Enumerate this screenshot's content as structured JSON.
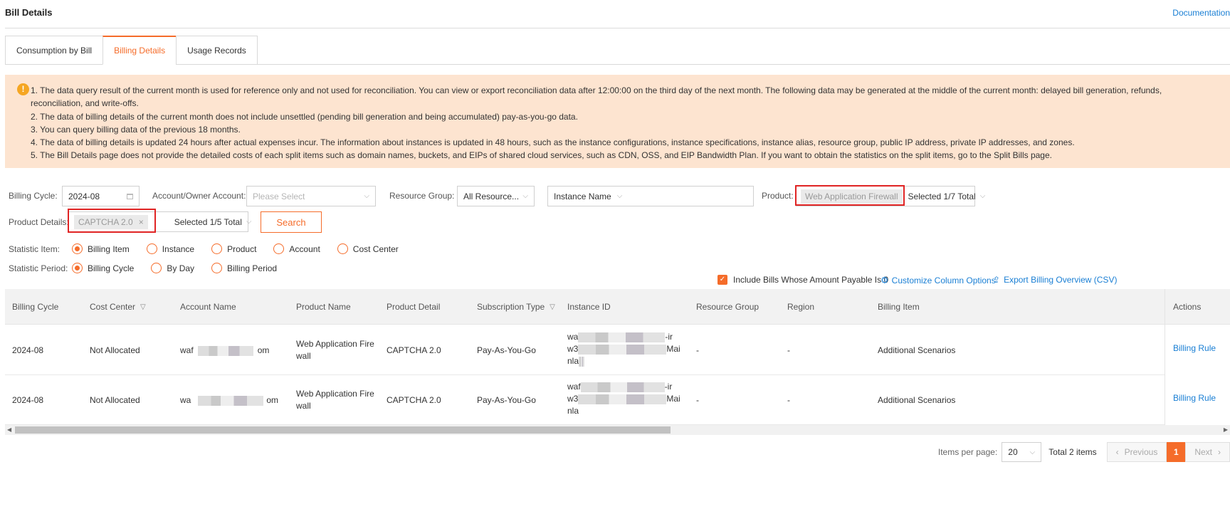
{
  "page": {
    "title": "Bill Details",
    "doc_link": "Documentation"
  },
  "tabs": [
    {
      "label": "Consumption by Bill",
      "active": false
    },
    {
      "label": "Billing Details",
      "active": true
    },
    {
      "label": "Usage Records",
      "active": false
    }
  ],
  "notice": {
    "icon": "info-icon",
    "lines": [
      "1. The data query result of the current month is used for reference only and not used for reconciliation. You can view or export reconciliation data after 12:00:00 on the third day of the next month. The following data may be generated at the middle of the current month: delayed bill generation, refunds,",
      "reconciliation, and write-offs.",
      "2. The data of billing details of the current month does not include unsettled (pending bill generation and being accumulated) pay-as-you-go data.",
      "3. You can query billing data of the previous 18 months.",
      "4. The data of billing details is updated 24 hours after actual expenses incur. The information about instances is updated in 48 hours, such as the instance configurations, instance specifications, instance alias, resource group, public IP address, private IP addresses, and zones.",
      "5. The Bill Details page does not provide the detailed costs of each split items such as domain names, buckets, and EIPs of shared cloud services, such as CDN, OSS, and EIP Bandwidth Plan. If you want to obtain the statistics on the split items, go to the Split Bills page."
    ]
  },
  "filters": {
    "billing_cycle_label": "Billing Cycle:",
    "billing_cycle_value": "2024-08",
    "account_label": "Account/Owner Account:",
    "account_placeholder": "Please Select",
    "resource_group_label": "Resource Group:",
    "resource_group_value": "All Resource...",
    "instance_name_value": "Instance Name",
    "product_label": "Product:",
    "product_tag": "Web Application Firewall",
    "product_selected": "Selected 1/7 Total",
    "product_details_label": "Product Details:",
    "product_details_tag": "CAPTCHA 2.0",
    "product_details_tag_close": "×",
    "product_details_selected": "Selected 1/5 Total",
    "search_label": "Search"
  },
  "statistic_item": {
    "label": "Statistic Item:",
    "options": [
      {
        "label": "Billing Item",
        "checked": true
      },
      {
        "label": "Instance",
        "checked": false
      },
      {
        "label": "Product",
        "checked": false
      },
      {
        "label": "Account",
        "checked": false
      },
      {
        "label": "Cost Center",
        "checked": false
      }
    ]
  },
  "statistic_period": {
    "label": "Statistic Period:",
    "options": [
      {
        "label": "Billing Cycle",
        "checked": true
      },
      {
        "label": "By Day",
        "checked": false
      },
      {
        "label": "Billing Period",
        "checked": false
      }
    ]
  },
  "toolbar": {
    "include_zero_label": "Include Bills Whose Amount Payable Is 0",
    "include_zero_checked": true,
    "customize_label": "Customize Column Options",
    "export_label": "Export Billing Overview (CSV)"
  },
  "table": {
    "columns": [
      "Billing Cycle",
      "Cost Center",
      "Account Name",
      "Product Name",
      "Product Detail",
      "Subscription Type",
      "Instance ID",
      "Resource Group",
      "Region",
      "Billing Item",
      "Actions"
    ],
    "rows": [
      {
        "billing_cycle": "2024-08",
        "cost_center": "Not Allocated",
        "account_prefix": "waf",
        "account_suffix": "om",
        "product_name_1": "Web Application Fire",
        "product_name_2": "wall",
        "product_detail": "CAPTCHA 2.0",
        "subscription_type": "Pay-As-You-Go",
        "instance_1a": "wa",
        "instance_1b": "-ir",
        "instance_2a": "w3",
        "instance_2b": "Mai",
        "instance_3a": "nla",
        "resource_group": "-",
        "region": "-",
        "billing_item": "Additional Scenarios",
        "action": "Billing Rule"
      },
      {
        "billing_cycle": "2024-08",
        "cost_center": "Not Allocated",
        "account_prefix": "wa",
        "account_suffix": "om",
        "product_name_1": "Web Application Fire",
        "product_name_2": "wall",
        "product_detail": "CAPTCHA 2.0",
        "subscription_type": "Pay-As-You-Go",
        "instance_1a": "waf",
        "instance_1b": "-ir",
        "instance_2a": "w3",
        "instance_2b": "Mai",
        "instance_3a": "nla",
        "resource_group": "-",
        "region": "-",
        "billing_item": "Additional Scenarios",
        "action": "Billing Rule"
      }
    ]
  },
  "pagination": {
    "items_per_page_label": "Items per page:",
    "items_per_page_value": "20",
    "total_label": "Total 2 items",
    "previous_label": "Previous",
    "current_page": "1",
    "next_label": "Next"
  },
  "colors": {
    "accent": "#f56c2a",
    "link": "#1a7fd4",
    "notice_bg": "#fde4d0",
    "highlight": "#e02424"
  }
}
